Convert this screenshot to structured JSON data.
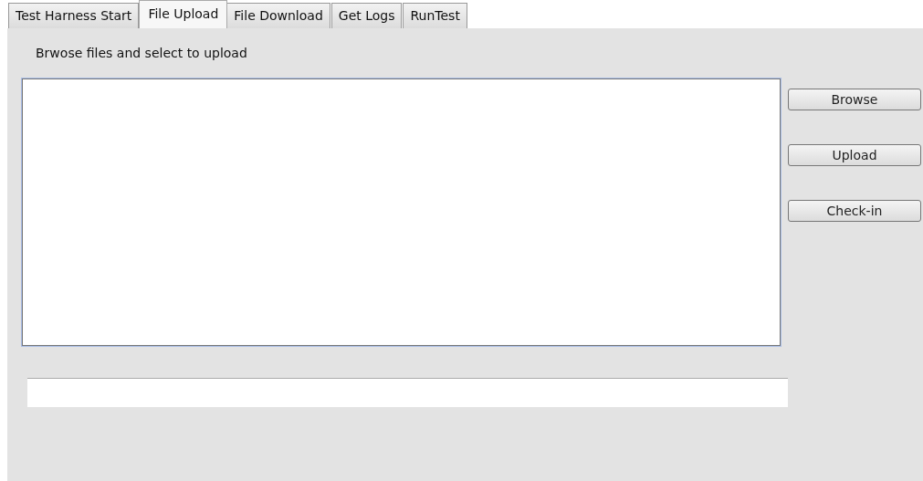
{
  "tabs": [
    {
      "label": "Test Harness Start",
      "selected": false
    },
    {
      "label": "File Upload",
      "selected": true
    },
    {
      "label": "File Download",
      "selected": false
    },
    {
      "label": "Get Logs",
      "selected": false
    },
    {
      "label": "RunTest",
      "selected": false
    }
  ],
  "instruction": "Brwose files and select to upload",
  "buttons": [
    "Browse",
    "Upload",
    "Check-in"
  ]
}
